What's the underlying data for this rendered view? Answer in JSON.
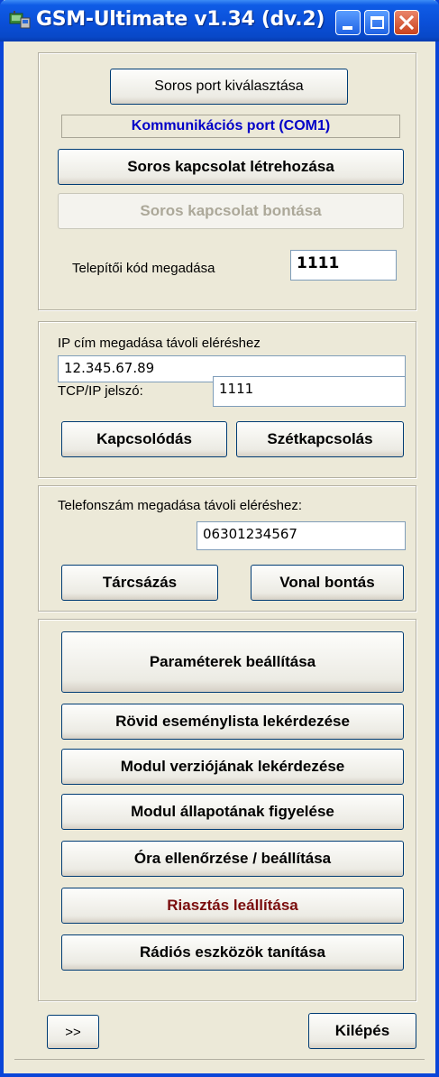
{
  "window": {
    "title": "GSM-Ultimate  v1.34 (dv.2)",
    "title_color": "#0a45d8"
  },
  "serial": {
    "select_port_label": "Soros port kiválasztása",
    "port_status": "Kommunikációs port (COM1)",
    "port_status_color": "#0000c8",
    "connect_label": "Soros kapcsolat létrehozása",
    "disconnect_label": "Soros kapcsolat bontása",
    "installer_code_label": "Telepítői kód megadása",
    "installer_code_value": "1111"
  },
  "tcp": {
    "ip_label": "IP cím megadása távoli eléréshez",
    "ip_value": "12.345.67.89",
    "password_label": "TCP/IP jelszó:",
    "password_value": "1111",
    "connect_label": "Kapcsolódás",
    "disconnect_label": "Szétkapcsolás"
  },
  "phone": {
    "label": "Telefonszám megadása távoli eléréshez:",
    "number_value": "06301234567",
    "dial_label": "Tárcsázás",
    "hangup_label": "Vonal bontás"
  },
  "actions": {
    "params_label": "Paraméterek beállítása",
    "event_list_label": "Rövid eseménylista lekérdezése",
    "module_version_label": "Modul verziójának lekérdezése",
    "module_status_label": "Modul állapotának figyelése",
    "clock_label": "Óra ellenőrzése / beállítása",
    "alarm_stop_label": "Riasztás leállítása",
    "alarm_stop_color": "#7a0d0d",
    "radio_learn_label": "Rádiós eszközök tanítása"
  },
  "footer": {
    "more_label": ">>",
    "exit_label": "Kilépés"
  }
}
